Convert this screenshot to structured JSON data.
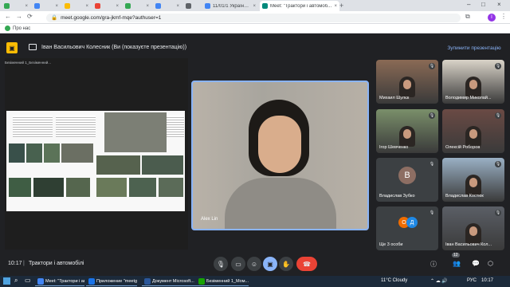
{
  "browser": {
    "tabs": [
      {
        "label": "",
        "color": "#34a853"
      },
      {
        "label": "",
        "color": "#4285f4"
      },
      {
        "label": "",
        "color": "#fbbc04"
      },
      {
        "label": "",
        "color": "#ea4335"
      },
      {
        "label": "",
        "color": "#34a853"
      },
      {
        "label": "",
        "color": "#4285f4"
      },
      {
        "label": "",
        "color": "#5f6368"
      },
      {
        "label": "",
        "color": "#8ab4f8"
      },
      {
        "label": "11/01/1 Україна – календар – ...",
        "color": "#4285f4"
      },
      {
        "label": "Meet: \"Трактори і автомоб...",
        "color": "#00897b",
        "active": true
      }
    ],
    "url": "meet.google.com/gra-jkmf-mqe?authuser=1",
    "bookmark": "Про нас",
    "profile_initial": "I"
  },
  "meet": {
    "presenter_title": "Іван Васильович Колесник (Ви (показуєте презентацію))",
    "stop_presenting": "Зупинити презентацію",
    "shared_window_title": "Безіменний 1_Безіменний...",
    "main_speaker": "Alex Lin",
    "participants": [
      {
        "name": "Михаил Шулєк",
        "kind": "video",
        "tone": "#8a6a55"
      },
      {
        "name": "Володимир Миколай...",
        "kind": "video",
        "tone": "#d9d3c8"
      },
      {
        "name": "Ігор Шевченко",
        "kind": "video",
        "tone": "#7a8f6a"
      },
      {
        "name": "Олексій Роборов",
        "kind": "video",
        "tone": "#6a4a44"
      },
      {
        "name": "Владислав Зубко",
        "kind": "letter",
        "letter": "В",
        "color": "#8d6e63"
      },
      {
        "name": "Владислав Костюк",
        "kind": "video",
        "tone": "#9ab0c4"
      },
      {
        "name": "Ще 3 особи",
        "kind": "group",
        "letters": [
          "О",
          "Д"
        ]
      },
      {
        "name": "Іван Васильович Кол...",
        "kind": "video",
        "tone": "#5b5f66"
      }
    ],
    "time": "10:17",
    "separator": "|",
    "meeting_title": "Трактори і автомобілі",
    "people_count": "12"
  },
  "taskbar": {
    "items": [
      {
        "label": "Meet: \"Трактори і авт...",
        "color": "#4285f4"
      },
      {
        "label": "Приложение \"meetg...",
        "color": "#1a73e8"
      },
      {
        "label": "Документ Microsoft...",
        "color": "#2b579a"
      },
      {
        "label": "Безіменний 1_Мом...",
        "color": "#18a303"
      }
    ],
    "weather": "11°C Cloudy",
    "lang": "РУС",
    "clock": "10:17"
  }
}
